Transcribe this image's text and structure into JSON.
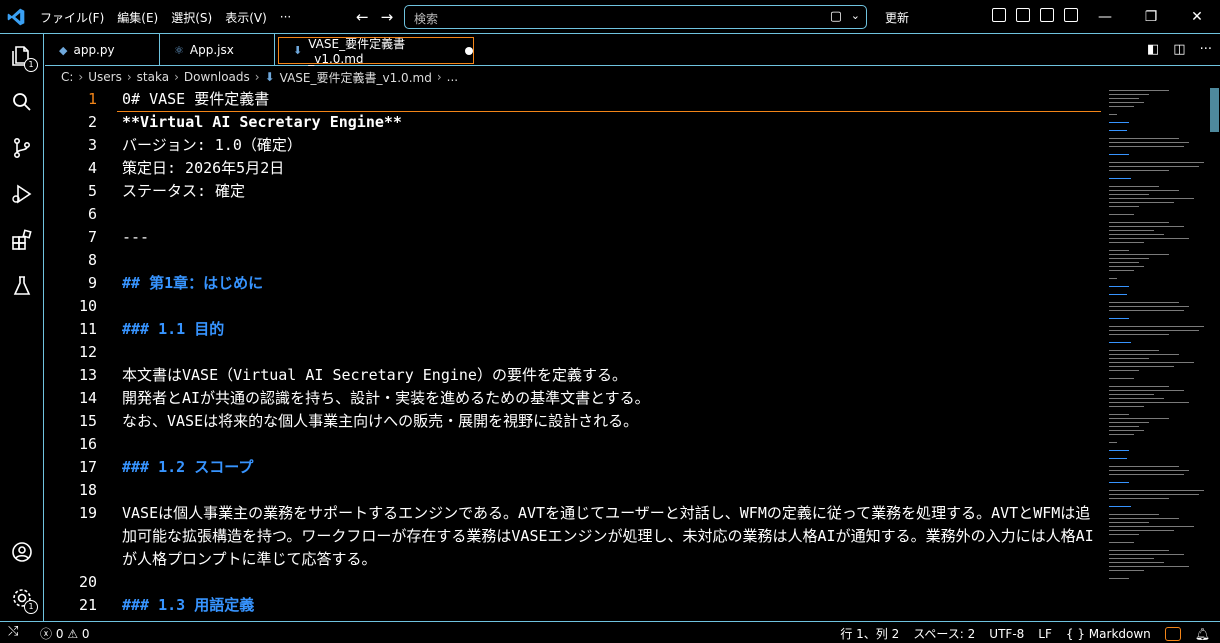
{
  "menu": [
    "ファイル(F)",
    "編集(E)",
    "選択(S)",
    "表示(V)",
    "···"
  ],
  "search": {
    "placeholder": "検索"
  },
  "update_label": "更新",
  "tabs": [
    {
      "label": "app.py",
      "icon": "python-icon"
    },
    {
      "label": "App.jsx",
      "icon": "react-icon"
    },
    {
      "label": "VASE_要件定義書_v1.0.md",
      "icon": "markdown-icon",
      "active": true,
      "modified": true
    }
  ],
  "breadcrumb": [
    "C:",
    "Users",
    "staka",
    "Downloads",
    "VASE_要件定義書_v1.0.md",
    "..."
  ],
  "activity_badges": {
    "explorer": "1",
    "settings": "1"
  },
  "editor": {
    "lines": [
      {
        "n": "1",
        "text": "0# VASE 要件定義書",
        "style": "plain"
      },
      {
        "n": "2",
        "text": "**Virtual AI Secretary Engine**",
        "style": "bold"
      },
      {
        "n": "3",
        "text": "バージョン: 1.0（確定）",
        "style": "plain"
      },
      {
        "n": "4",
        "text": "策定日: 2026年5月2日",
        "style": "plain"
      },
      {
        "n": "5",
        "text": "ステータス: 確定",
        "style": "plain"
      },
      {
        "n": "6",
        "text": "",
        "style": "plain"
      },
      {
        "n": "7",
        "text": "---",
        "style": "plain"
      },
      {
        "n": "8",
        "text": "",
        "style": "plain"
      },
      {
        "n": "9",
        "text": "## 第1章：はじめに",
        "style": "head"
      },
      {
        "n": "10",
        "text": "",
        "style": "plain"
      },
      {
        "n": "11",
        "text": "### 1.1 目的",
        "style": "head"
      },
      {
        "n": "12",
        "text": "",
        "style": "plain"
      },
      {
        "n": "13",
        "text": "本文書はVASE（Virtual AI Secretary Engine）の要件を定義する。",
        "style": "plain"
      },
      {
        "n": "14",
        "text": "開発者とAIが共通の認識を持ち、設計・実装を進めるための基準文書とする。",
        "style": "plain"
      },
      {
        "n": "15",
        "text": "なお、VASEは将来的な個人事業主向けへの販売・展開を視野に設計される。",
        "style": "plain"
      },
      {
        "n": "16",
        "text": "",
        "style": "plain"
      },
      {
        "n": "17",
        "text": "### 1.2 スコープ",
        "style": "head"
      },
      {
        "n": "18",
        "text": "",
        "style": "plain"
      },
      {
        "n": "19",
        "text": "VASEは個人事業主の業務をサポートするエンジンである。AVTを通じてユーザーと対話し、WFMの定義に従って業務を処理する。AVTとWFMは追加可能な拡張構造を持つ。ワークフローが存在する業務はVASEエンジンが処理し、未対応の業務は人格AIが通知する。業務外の入力には人格AIが人格プロンプトに準じて応答する。",
        "style": "wrap"
      },
      {
        "n": "20",
        "text": "",
        "style": "plain"
      },
      {
        "n": "21",
        "text": "### 1.3 用語定義",
        "style": "head"
      }
    ]
  },
  "status": {
    "problems_errors": "0",
    "problems_warnings": "0",
    "position": "行 1、列 2",
    "spaces": "スペース: 2",
    "encoding": "UTF-8",
    "eol": "LF",
    "language": "Markdown"
  },
  "colors": {
    "accent": "#6fc3df",
    "active_border": "#f38518",
    "heading": "#3794ff"
  }
}
